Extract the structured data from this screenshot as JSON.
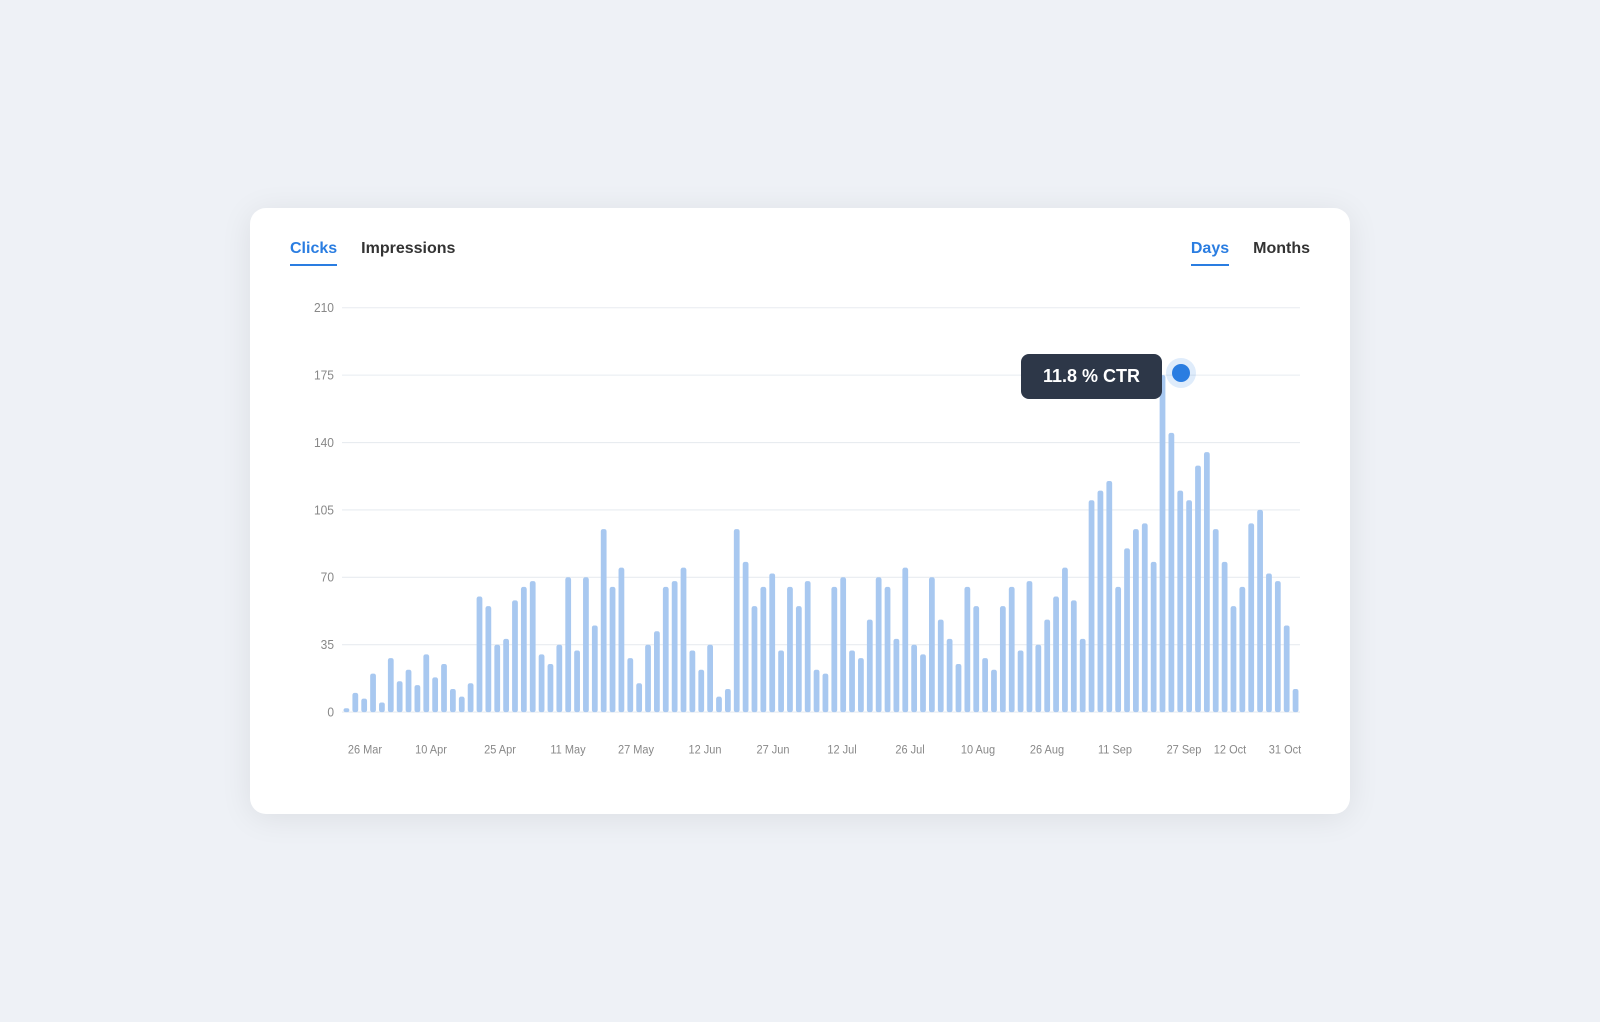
{
  "tabs_left": [
    {
      "label": "Clicks",
      "active": true
    },
    {
      "label": "Impressions",
      "active": false
    }
  ],
  "tabs_right": [
    {
      "label": "Days",
      "active": true
    },
    {
      "label": "Months",
      "active": false
    }
  ],
  "tooltip": {
    "text": "11.8 % CTR"
  },
  "y_axis": [
    "210",
    "175",
    "140",
    "105",
    "70",
    "35",
    "0"
  ],
  "x_axis": [
    "26 Mar",
    "10 Apr",
    "25 Apr",
    "11 May",
    "27 May",
    "12 Jun",
    "27 Jun",
    "12 Jul",
    "26 Jul",
    "10 Aug",
    "26 Aug",
    "11 Sep",
    "27 Sep",
    "12 Oct",
    "31 Oct"
  ],
  "bars": [
    2,
    10,
    7,
    20,
    5,
    28,
    16,
    22,
    14,
    30,
    18,
    25,
    12,
    8,
    15,
    60,
    55,
    35,
    38,
    58,
    65,
    68,
    30,
    25,
    35,
    70,
    32,
    70,
    45,
    95,
    65,
    75,
    28,
    15,
    35,
    42,
    65,
    68,
    75,
    32,
    22,
    35,
    8,
    12,
    95,
    78,
    55,
    65,
    72,
    32,
    65,
    55,
    68,
    22,
    20,
    65,
    70,
    32,
    28,
    48,
    70,
    65,
    38,
    75,
    35,
    30,
    70,
    48,
    38,
    25,
    65,
    55,
    28,
    22,
    55,
    65,
    32,
    68,
    35,
    48,
    60,
    75,
    58,
    38,
    110,
    115,
    120,
    65,
    85,
    95,
    98,
    78,
    175,
    145,
    115,
    110,
    128,
    135,
    95,
    78,
    55,
    65,
    98,
    105,
    72,
    68,
    45,
    12
  ]
}
